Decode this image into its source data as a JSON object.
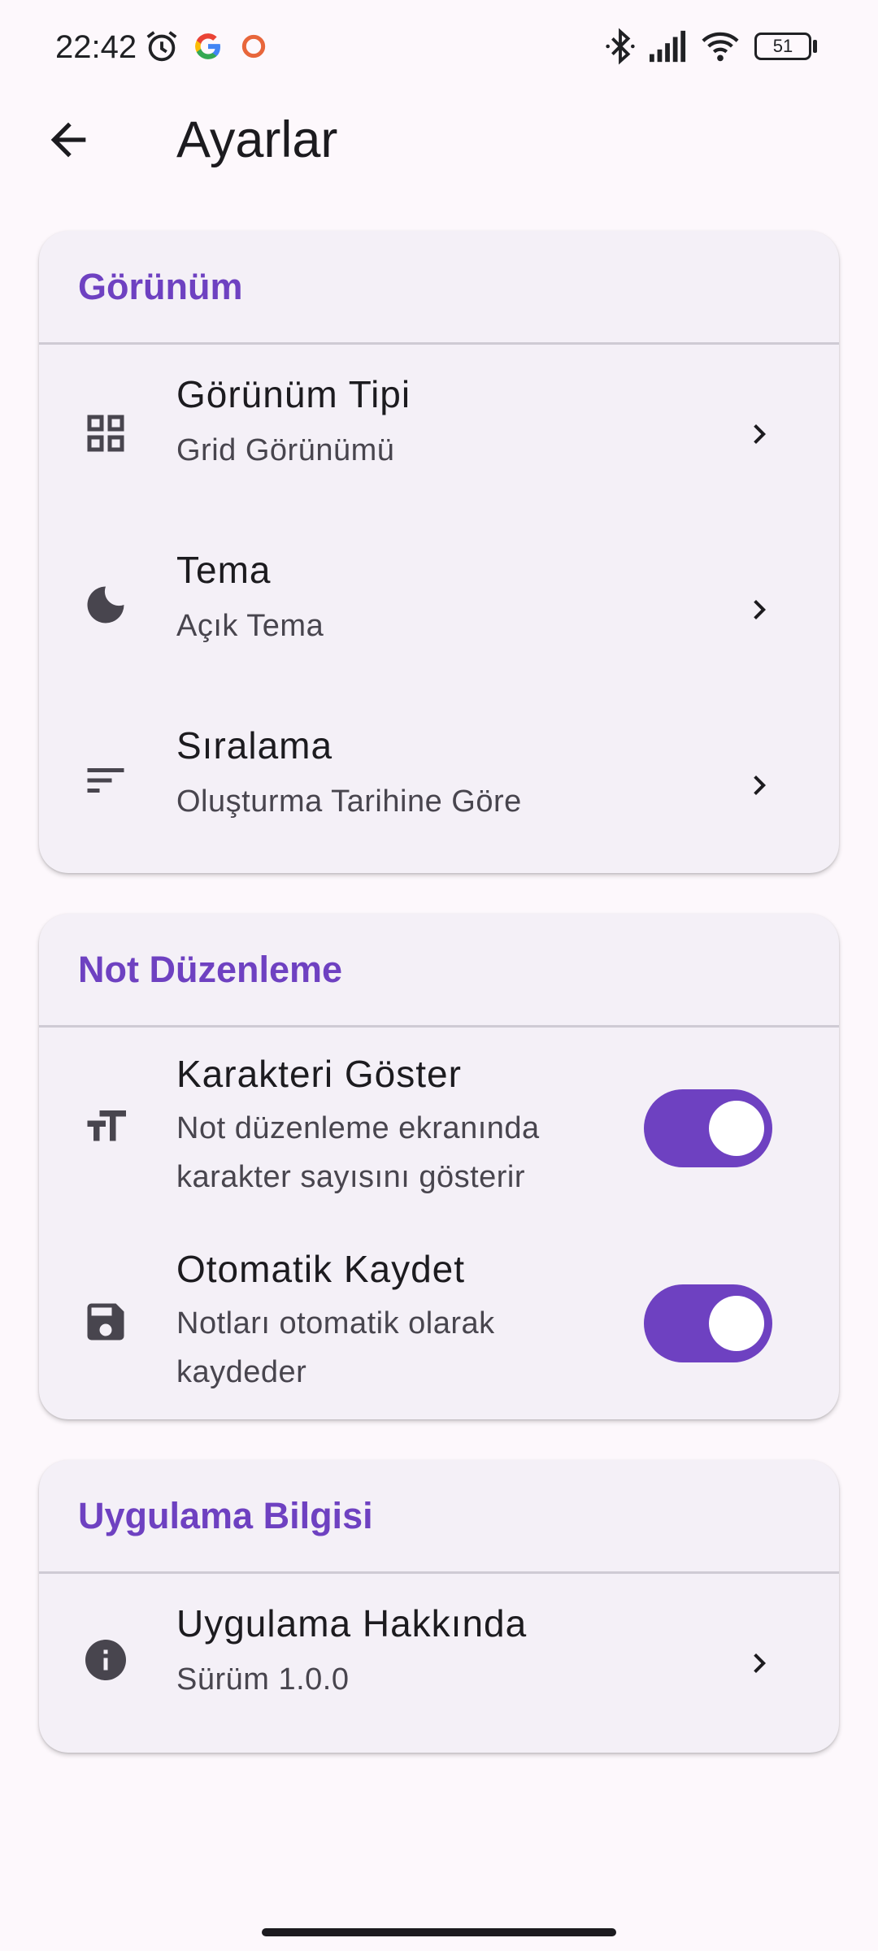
{
  "status_bar": {
    "time": "22:42",
    "battery": "51",
    "icons": [
      "alarm-icon",
      "google-icon",
      "record-icon",
      "bluetooth-icon",
      "signal-icon",
      "wifi-icon",
      "battery-icon"
    ]
  },
  "app_bar": {
    "title": "Ayarlar",
    "back_icon": "arrow-back-icon"
  },
  "sections": {
    "appearance": {
      "title": "Görünüm",
      "view_type": {
        "label": "Görünüm Tipi",
        "value": "Grid Görünümü",
        "icon": "grid-view-icon"
      },
      "theme": {
        "label": "Tema",
        "value": "Açık Tema",
        "icon": "moon-icon"
      },
      "sort": {
        "label": "Sıralama",
        "value": "Oluşturma Tarihine Göre",
        "icon": "sort-icon"
      }
    },
    "editing": {
      "title": "Not Düzenleme",
      "show_chars": {
        "label": "Karakteri Göster",
        "desc_line1": "Not düzenleme ekranında",
        "desc_line2": "karakter sayısını gösterir",
        "enabled": true,
        "icon": "text-size-icon"
      },
      "auto_save": {
        "label": "Otomatik Kaydet",
        "desc_line1": "Notları otomatik olarak",
        "desc_line2": "kaydeder",
        "enabled": true,
        "icon": "save-icon"
      }
    },
    "app_info": {
      "title": "Uygulama Bilgisi",
      "about": {
        "label": "Uygulama Hakkında",
        "value": "Sürüm 1.0.0",
        "icon": "info-icon"
      }
    }
  },
  "colors": {
    "accent": "#6E41C1",
    "background": "#FDF8FC",
    "card": "#F4F0F7",
    "divider": "#CFCBD4"
  }
}
